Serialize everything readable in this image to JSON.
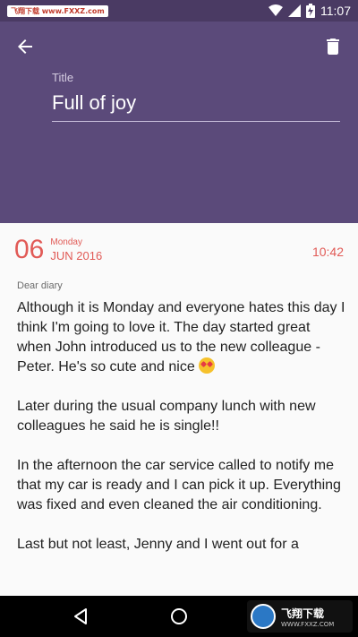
{
  "status_bar": {
    "watermark": "飞翔下载 www.FXXZ.com",
    "time": "11:07"
  },
  "header": {
    "back_icon": "arrow-left-icon",
    "delete_icon": "trash-icon",
    "title_label": "Title",
    "title_value": "Full of joy"
  },
  "entry": {
    "day": "06",
    "weekday": "Monday",
    "month_year": "JUN 2016",
    "time": "10:42",
    "subtitle": "Dear diary",
    "paragraphs": [
      "Although it is Monday and everyone hates this day I think I'm going to love it. The day started great when John introduced us to the new colleague - Peter. He's so cute and nice",
      "Later during the usual company lunch with new colleagues he said he is single!!",
      "In the afternoon the car service called to notify me that my car is ready and I can pick it up. Everything was fixed and even cleaned the air conditioning.",
      "Last but not least, Jenny and I went out for a"
    ]
  },
  "nav": {
    "back_icon": "nav-back-icon",
    "home_icon": "nav-home-icon",
    "brand_text": "飞翔下载",
    "brand_sub": "WWW.FXXZ.COM"
  }
}
